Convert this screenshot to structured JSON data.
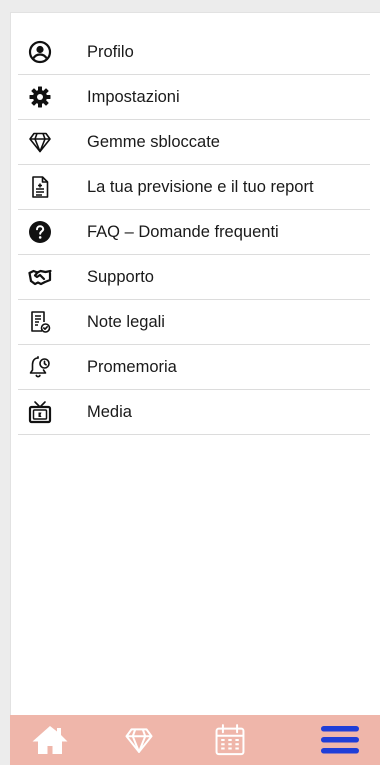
{
  "menu": {
    "items": [
      {
        "label": "Profilo",
        "icon": "user-circle-icon"
      },
      {
        "label": "Impostazioni",
        "icon": "gear-icon"
      },
      {
        "label": "Gemme sbloccate",
        "icon": "diamond-icon"
      },
      {
        "label": "La tua previsione e il tuo report",
        "icon": "document-icon"
      },
      {
        "label": "FAQ – Domande frequenti",
        "icon": "question-circle-icon"
      },
      {
        "label": "Supporto",
        "icon": "handshake-icon"
      },
      {
        "label": "Note legali",
        "icon": "legal-document-icon"
      },
      {
        "label": "Promemoria",
        "icon": "bell-clock-icon"
      },
      {
        "label": "Media",
        "icon": "tv-icon"
      }
    ]
  },
  "bottom_nav": {
    "tabs": [
      {
        "icon": "home-icon",
        "active": false
      },
      {
        "icon": "diamond-icon",
        "active": false
      },
      {
        "icon": "calendar-icon",
        "active": false
      },
      {
        "icon": "menu-icon",
        "active": true
      }
    ]
  },
  "colors": {
    "bottom_bar": "#efb6aa",
    "inactive_icon": "#ffffff",
    "active_icon": "#1f3ed8",
    "text": "#1a1a1a"
  }
}
